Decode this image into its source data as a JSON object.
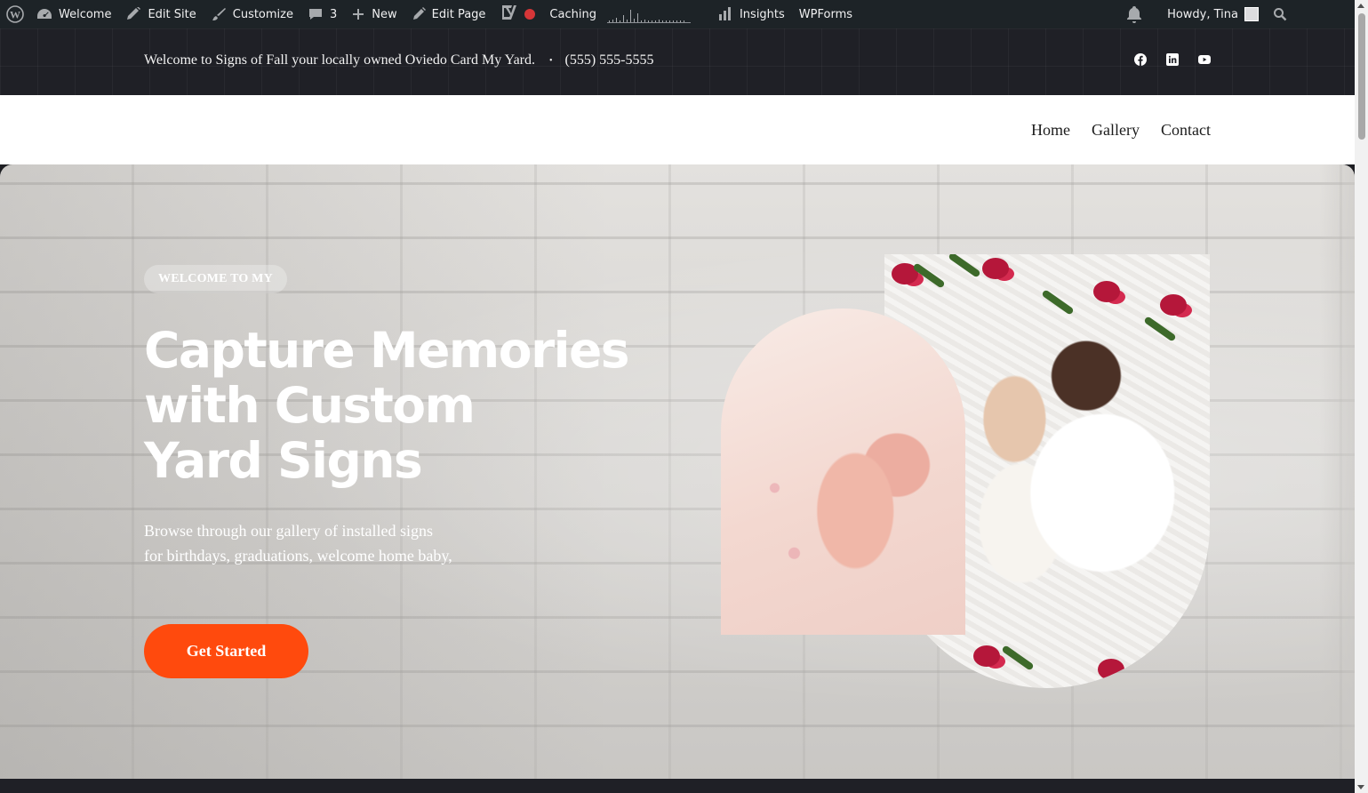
{
  "adminbar": {
    "items": [
      {
        "label": "Welcome",
        "icon": "dashboard-icon"
      },
      {
        "label": "Edit Site",
        "icon": "brush-icon"
      },
      {
        "label": "Customize",
        "icon": "paintbrush-icon"
      },
      {
        "label": "3",
        "icon": "comment-icon"
      },
      {
        "label": "New",
        "icon": "plus-icon"
      },
      {
        "label": "Edit Page",
        "icon": "pencil-icon"
      },
      {
        "label": "Caching",
        "icon": "record-dot-icon"
      },
      {
        "label": "Insights",
        "icon": "bar-chart-icon"
      },
      {
        "label": "WPForms",
        "icon": ""
      }
    ],
    "howdy": "Howdy, Tina"
  },
  "topbar": {
    "welcome": "Welcome to Signs of Fall your locally owned Oviedo Card My Yard.",
    "separator": "•",
    "phone": "(555) 555-5555",
    "socials": [
      "facebook-icon",
      "linkedin-icon",
      "youtube-icon"
    ]
  },
  "nav": {
    "items": [
      "Home",
      "Gallery",
      "Contact"
    ]
  },
  "hero": {
    "badge": "WELCOME TO MY",
    "headline": [
      "Capture Memories",
      "with Custom",
      "Yard Signs"
    ],
    "lead": [
      "Browse through our gallery of installed signs",
      "for birthdays, graduations, welcome home baby,"
    ],
    "cta": "Get Started"
  },
  "colors": {
    "accent": "#ff4a0d",
    "adminbar": "#1d2327",
    "topbar": "#1f2026",
    "recording": "#d63638"
  }
}
